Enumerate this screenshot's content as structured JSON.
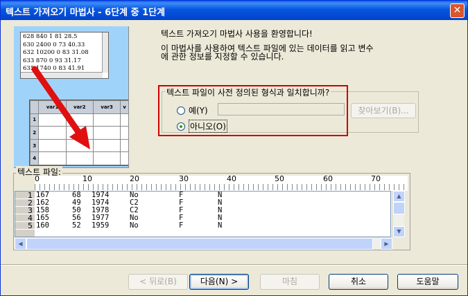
{
  "window": {
    "title": "텍스트 가져오기 마법사 - 6단계 중 1단계",
    "close_glyph": "✕"
  },
  "illustration": {
    "sample_lines": [
      "628 840 1 81 28.5",
      "630 2400 0 73 40.33",
      "632 10200 0 83 31.08",
      "633 870 0 93 31.17",
      "635 1740 0 83 41.91"
    ],
    "grid_headers": [
      "var1",
      "var2",
      "var3",
      "v"
    ],
    "grid_rows": [
      "1",
      "2",
      "3",
      "4"
    ]
  },
  "intro": {
    "line1": "텍스트 가져오기 마법사 사용을 환영합니다!",
    "line2": "이 마법사를 사용하여 텍스트 파일에 있는 데이터를 읽고 변수",
    "line3": "에 관한 정보를 지정할 수 있습니다."
  },
  "format_group": {
    "legend": "텍스트 파일이 사전 정의된 형식과 일치합니까?",
    "yes_label": "예(Y)",
    "no_label": "아니오(O)",
    "selected": "no",
    "browse_label": "찾아보기(B)..."
  },
  "preview": {
    "label": "텍스트 파일:",
    "ruler_labels": [
      "0",
      "10",
      "20",
      "30",
      "40",
      "50",
      "60",
      "70"
    ],
    "rows": [
      {
        "n": "1",
        "c": [
          "167",
          "68",
          "1974",
          "No",
          "F",
          "N"
        ]
      },
      {
        "n": "2",
        "c": [
          "162",
          "49",
          "1974",
          "C2",
          "F",
          "N"
        ]
      },
      {
        "n": "3",
        "c": [
          "158",
          "50",
          "1978",
          "C2",
          "F",
          "N"
        ]
      },
      {
        "n": "4",
        "c": [
          "165",
          "56",
          "1977",
          "No",
          "F",
          "N"
        ]
      },
      {
        "n": "5",
        "c": [
          "160",
          "52",
          "1959",
          "No",
          "F",
          "N"
        ]
      }
    ]
  },
  "buttons": {
    "back": "< 뒤로(B)",
    "next": "다음(N) >",
    "finish": "마침",
    "cancel": "취소",
    "help": "도움말"
  }
}
